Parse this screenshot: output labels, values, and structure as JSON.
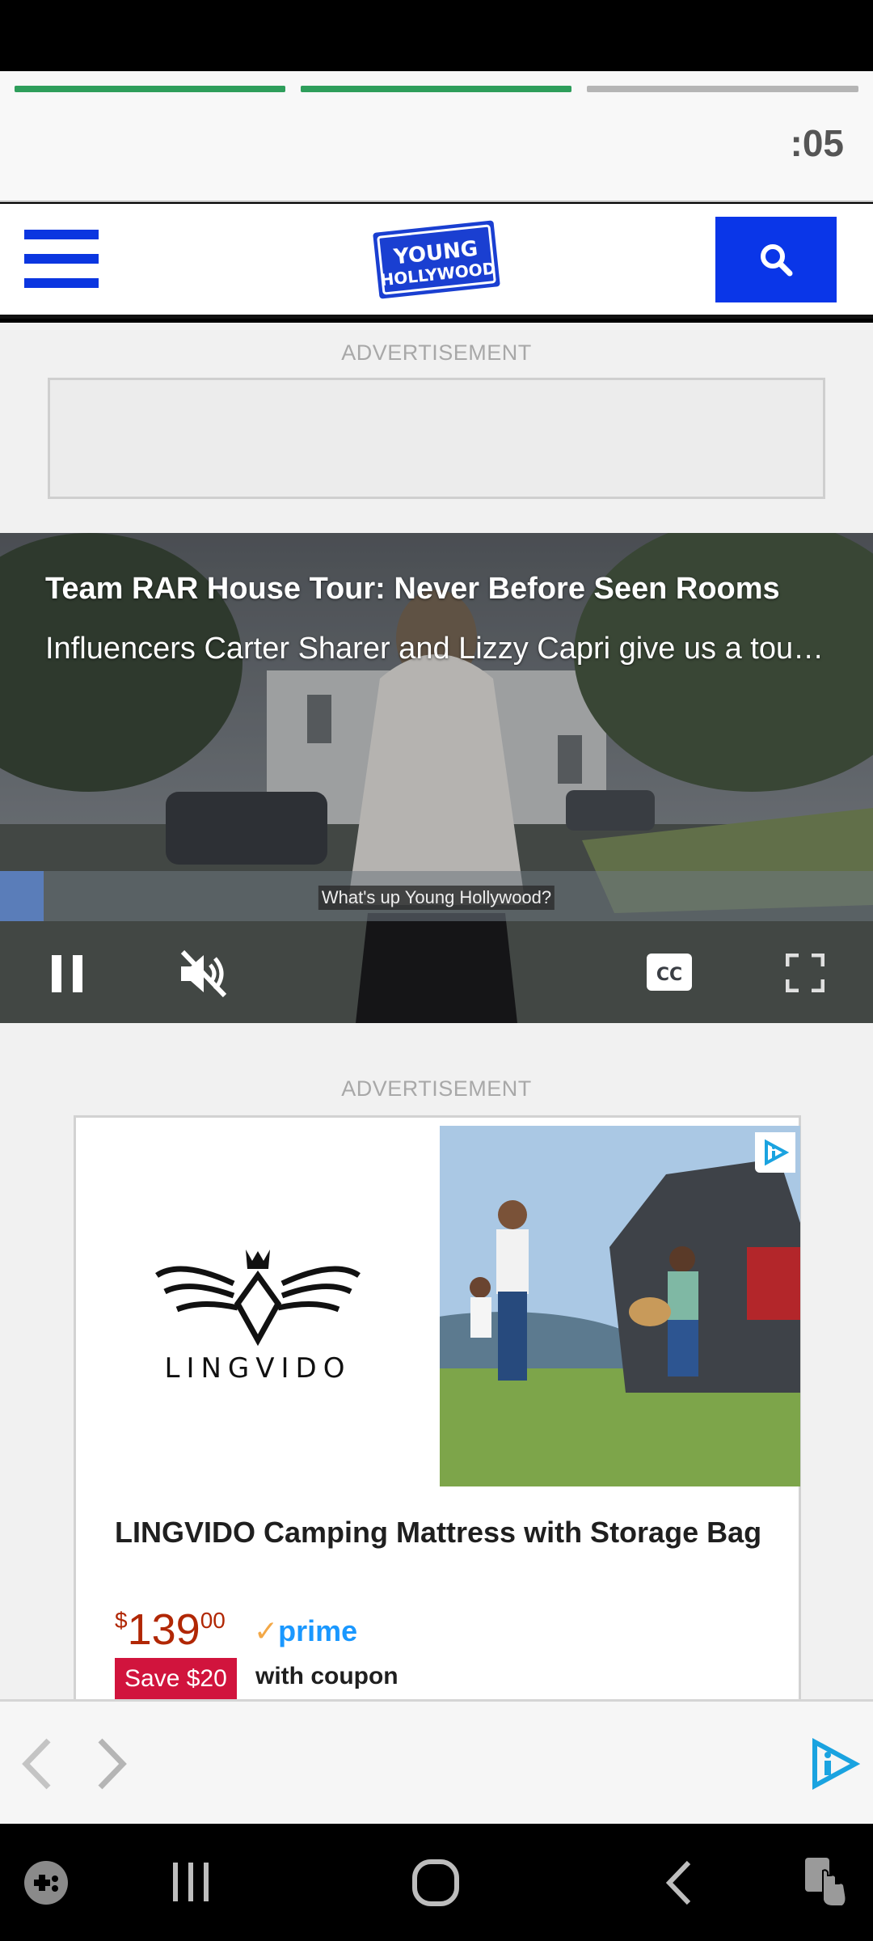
{
  "story": {
    "countdown": ":05",
    "progress": [
      1.0,
      1.0,
      0.0
    ]
  },
  "header": {
    "logo_text_line1": "YOUNG",
    "logo_text_line2": "HOLLYWOOD",
    "menu_icon": "hamburger-menu-icon",
    "search_icon": "search-icon"
  },
  "ads": {
    "label_top": "ADVERTISEMENT",
    "label_bottom": "ADVERTISEMENT"
  },
  "video": {
    "title": "Team RAR House Tour: Never Before Seen Rooms",
    "description": "Influencers Carter Sharer and Lizzy Capri give us a tour of their never before seen rooms",
    "caption": "What's up Young Hollywood?",
    "progress": 0.05,
    "controls": [
      "pause-icon",
      "muted-icon",
      "closed-captions-icon",
      "fullscreen-icon"
    ]
  },
  "product_ad": {
    "brand": "LINGVIDO",
    "title": "LINGVIDO Camping Mattress with Storage Bag",
    "price_currency": "$",
    "price_whole": "139",
    "price_cents": "00",
    "prime_label": "prime",
    "coupon_badge": "Save $20",
    "coupon_text": "with coupon"
  },
  "colors": {
    "brand_blue": "#0a36e8",
    "progress_green": "#2e9e5b",
    "price_red": "#b12704",
    "prime_blue": "#1a98ff",
    "coupon_red": "#d1143d"
  }
}
